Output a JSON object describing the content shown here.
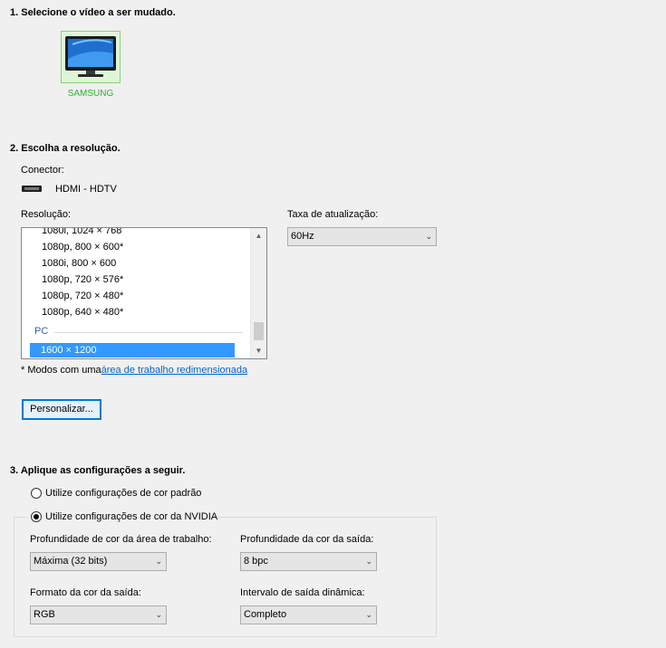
{
  "sections": {
    "step1_title": "1. Selecione o vídeo a ser mudado.",
    "step2_title": "2. Escolha a resolução.",
    "step3_title": "3. Aplique as configurações a seguir."
  },
  "display": {
    "name": "SAMSUNG",
    "icon": "monitor-icon",
    "accent_color": "#2db32d"
  },
  "connector": {
    "label": "Conector:",
    "value": "HDMI - HDTV",
    "icon": "hdmi-icon"
  },
  "resolution": {
    "label": "Resolução:",
    "items": [
      "1080i, 1024 × 768",
      "1080p, 800 × 600*",
      "1080i, 800 × 600",
      "1080p, 720 × 576*",
      "1080p, 720 × 480*",
      "1080p, 640 × 480*"
    ],
    "group_label": "PC",
    "selected": "1600 × 1200",
    "selected_color": "#3399ff"
  },
  "refresh": {
    "label": "Taxa de atualização:",
    "value": "60Hz"
  },
  "note": {
    "prefix": "* Modos com uma",
    "link": "área de trabalho redimensionada"
  },
  "customize_button": "Personalizar...",
  "color_settings": {
    "default_option": "Utilize configurações de cor padrão",
    "nvidia_option": "Utilize configurações de cor da NVIDIA",
    "selected": "nvidia",
    "desktop_depth": {
      "label": "Profundidade de cor da área de trabalho:",
      "value": "Máxima (32 bits)"
    },
    "output_depth": {
      "label": "Profundidade da cor da saída:",
      "value": "8 bpc"
    },
    "output_format": {
      "label": "Formato da cor da saída:",
      "value": "RGB"
    },
    "dynamic_range": {
      "label": "Intervalo de saída dinâmica:",
      "value": "Completo"
    }
  }
}
